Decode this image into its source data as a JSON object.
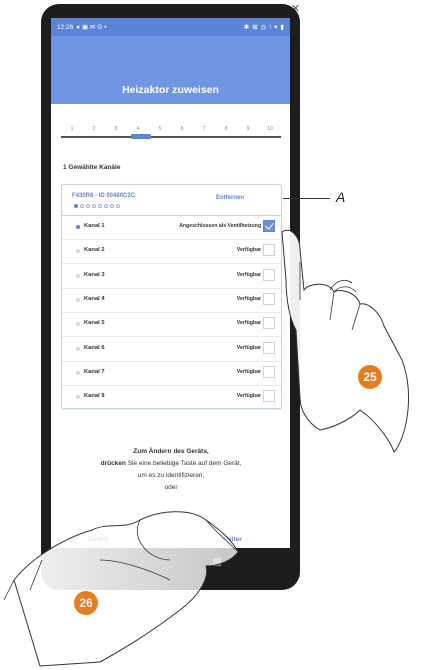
{
  "status_bar": {
    "time": "12:26"
  },
  "screen": {
    "title": "Heizaktor zuweisen",
    "steps": [
      "1",
      "2",
      "3",
      "4",
      "5",
      "6",
      "7",
      "8",
      "9",
      "10"
    ],
    "active_step": "4",
    "selected_channels_label": "1 Gewählte Kanäle",
    "device": {
      "id": "F430R8 - ID 00480C2C",
      "remove_label": "Entfernen",
      "pages": 8,
      "current_page": 1
    },
    "channels": [
      {
        "name": "Kanal 1",
        "status": "Angeschlossen als Ventilheizung",
        "checked": true
      },
      {
        "name": "Kanal 2",
        "status": "Verfügbar",
        "checked": false
      },
      {
        "name": "Kanal 3",
        "status": "Verfügbar",
        "checked": false
      },
      {
        "name": "Kanal 4",
        "status": "Verfügbar",
        "checked": false
      },
      {
        "name": "Kanal 5",
        "status": "Verfügbar",
        "checked": false
      },
      {
        "name": "Kanal 6",
        "status": "Verfügbar",
        "checked": false
      },
      {
        "name": "Kanal 7",
        "status": "Verfügbar",
        "checked": false
      },
      {
        "name": "Kanal 8",
        "status": "Verfügbar",
        "checked": false
      }
    ],
    "info": {
      "line1": "Zum Ändern des Geräts,",
      "line2_bold": "drücken",
      "line2_rest": " Sie eine beliebige Taste auf dem Gerät,",
      "line3": "um es zu identifizieren,",
      "line4": "oder"
    },
    "back_label": "Zurück",
    "next_label": "Weiter"
  },
  "annotation": {
    "label": "A"
  },
  "badges": {
    "first": "25",
    "second": "26"
  },
  "colors": {
    "header": "#7095e3",
    "accent": "#5b83d6",
    "badge": "#e57d22"
  }
}
